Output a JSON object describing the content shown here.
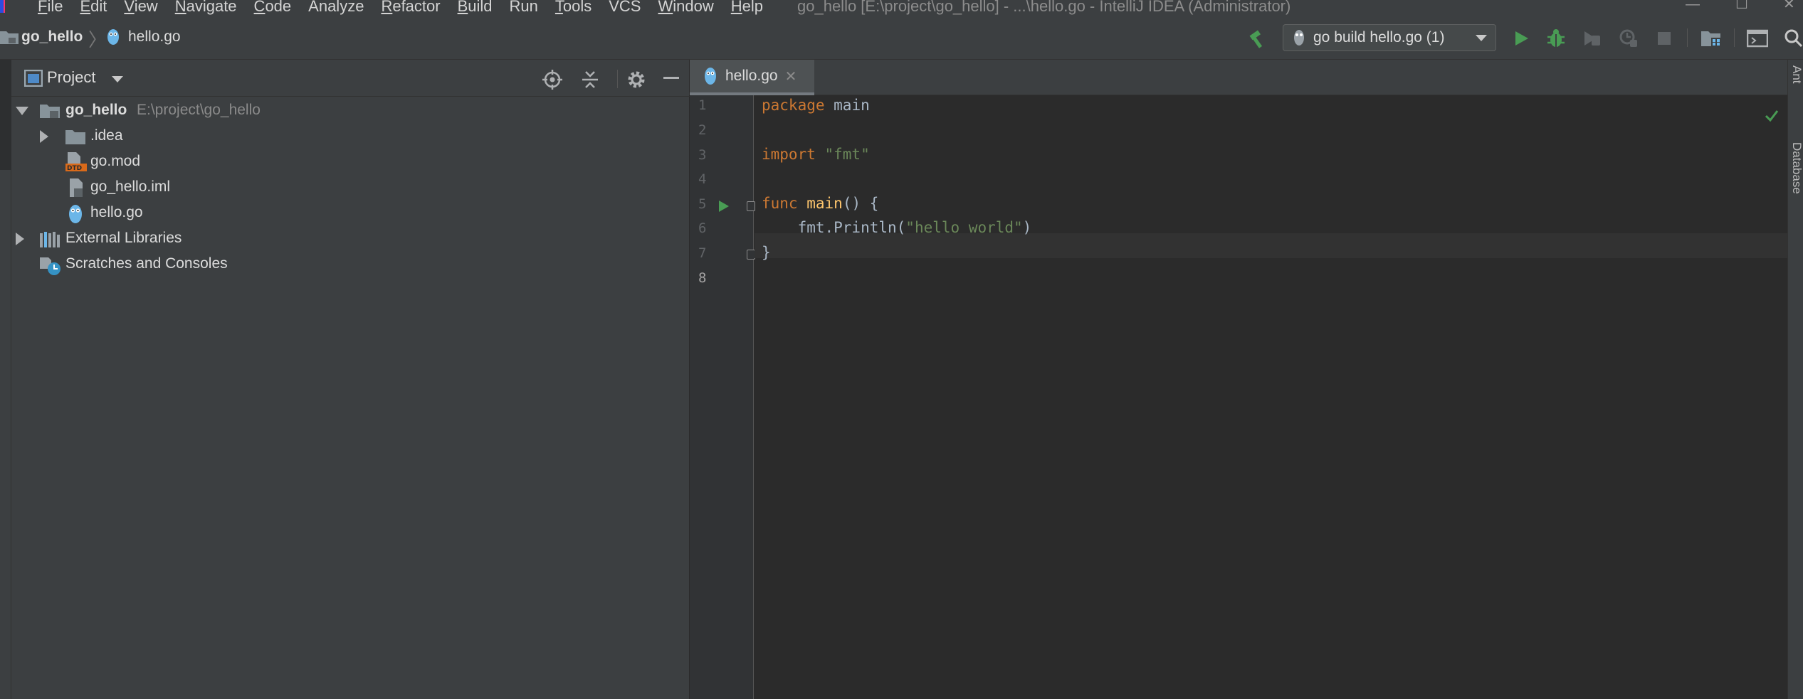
{
  "window": {
    "title": "go_hello [E:\\project\\go_hello] - ...\\hello.go - IntelliJ IDEA (Administrator)",
    "controls": [
      "—",
      "☐",
      "✕"
    ]
  },
  "menu": [
    {
      "label": "File",
      "mnemonic": "F",
      "rest": "ile"
    },
    {
      "label": "Edit",
      "mnemonic": "E",
      "rest": "dit"
    },
    {
      "label": "View",
      "mnemonic": "V",
      "rest": "iew"
    },
    {
      "label": "Navigate",
      "mnemonic": "N",
      "rest": "avigate"
    },
    {
      "label": "Code",
      "mnemonic": "C",
      "rest": "ode"
    },
    {
      "label": "Analyze",
      "mnemonic": "",
      "rest": "Analyze"
    },
    {
      "label": "Refactor",
      "mnemonic": "R",
      "rest": "efactor"
    },
    {
      "label": "Build",
      "mnemonic": "B",
      "rest": "uild"
    },
    {
      "label": "Run",
      "mnemonic": "",
      "rest": "Run"
    },
    {
      "label": "Tools",
      "mnemonic": "T",
      "rest": "ools"
    },
    {
      "label": "VCS",
      "mnemonic": "",
      "rest": "VCS"
    },
    {
      "label": "Window",
      "mnemonic": "W",
      "rest": "indow"
    },
    {
      "label": "Help",
      "mnemonic": "H",
      "rest": "elp"
    }
  ],
  "breadcrumb": {
    "project": "go_hello",
    "file": "hello.go"
  },
  "toolbar": {
    "run_config": "go build hello.go (1)",
    "icons": [
      "build-hammer-icon",
      "run-icon",
      "debug-icon",
      "coverage-icon",
      "profile-icon",
      "stop-icon",
      "project-structure-icon",
      "terminal-icon",
      "search-icon"
    ]
  },
  "project_panel": {
    "title": "Project",
    "tree": {
      "root_name": "go_hello",
      "root_path": "E:\\project\\go_hello",
      "idea": ".idea",
      "gomod": "go.mod",
      "iml": "go_hello.iml",
      "hellogo": "hello.go",
      "external": "External Libraries",
      "scratches": "Scratches and Consoles"
    }
  },
  "editor": {
    "tab": "hello.go",
    "line_numbers": [
      "1",
      "2",
      "3",
      "4",
      "5",
      "6",
      "7",
      "8"
    ],
    "code": {
      "l1_kw": "package",
      "l1_rest": " main",
      "l3_kw": "import",
      "l3_str": " \"fmt\"",
      "l5_kw": "func",
      "l5_fn": "main",
      "l5_rest": "() {",
      "l6_indent": "    fmt.Println(",
      "l6_str": "\"hello world\"",
      "l6_end": ")",
      "l7": "}"
    }
  },
  "right_strip": {
    "tabs": [
      "Ant",
      "Database"
    ]
  },
  "colors": {
    "keyword": "#cc7832",
    "function": "#ffc66d",
    "string": "#6a8759",
    "run_green": "#499c54",
    "go_blue": "#6cb6e8"
  }
}
